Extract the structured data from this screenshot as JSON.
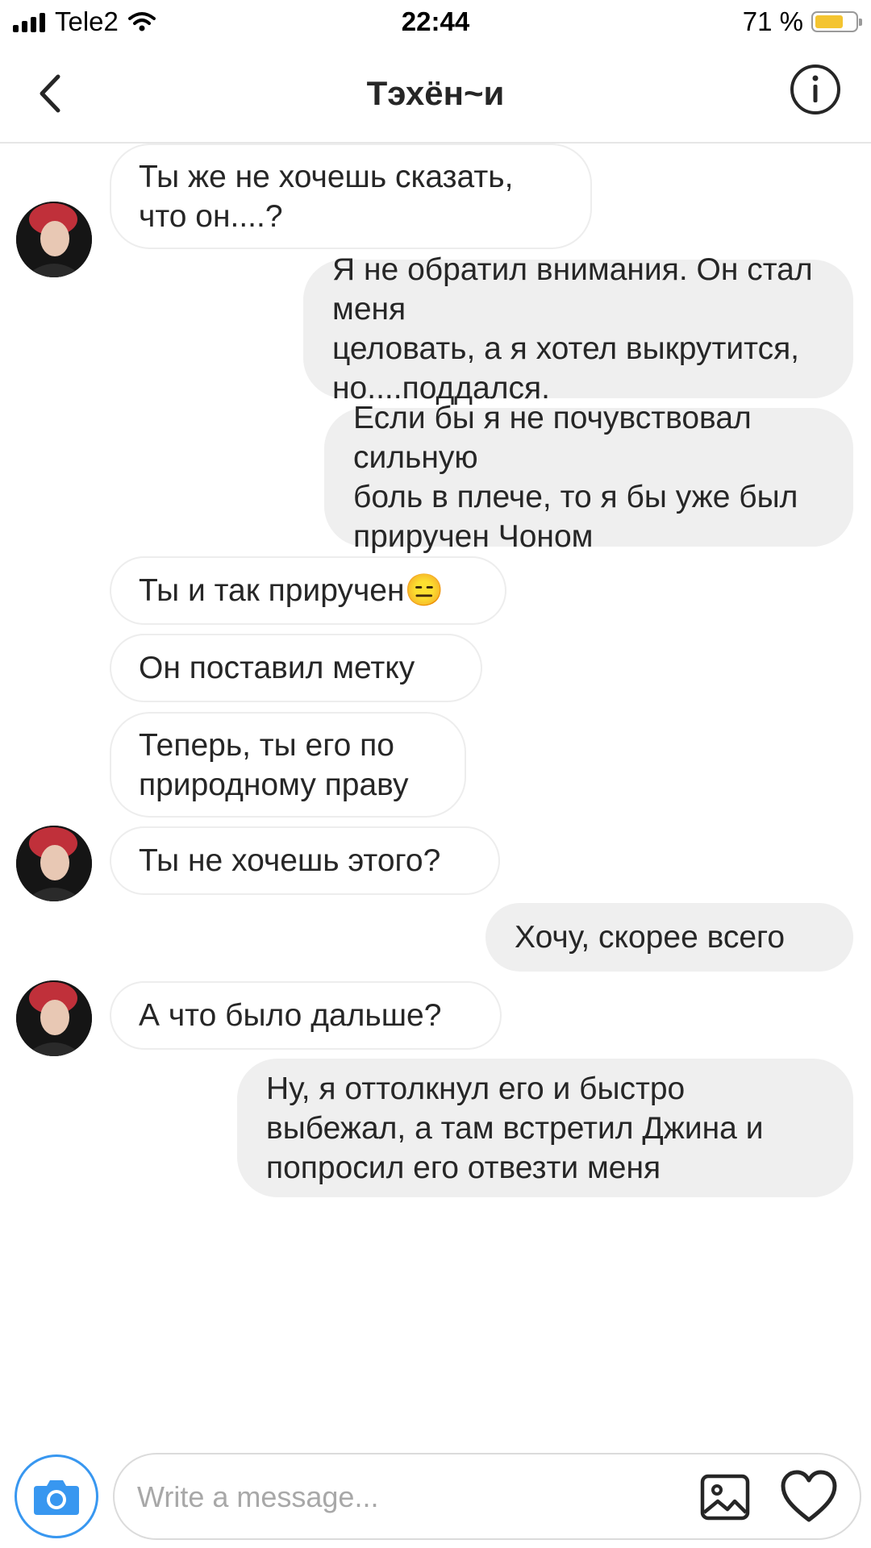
{
  "status_bar": {
    "carrier": "Tele2",
    "time": "22:44",
    "battery_percent": "71 %",
    "battery_level": 0.71
  },
  "header": {
    "title": "Тэхён~и"
  },
  "messages": [
    {
      "text": "Ты же не хочешь сказать,\nчто он....?",
      "direction": "in",
      "avatar": true
    },
    {
      "text": "Я не обратил внимания. Он стал меня\nцеловать, а я хотел выкрутится,\nно....поддался.",
      "direction": "out",
      "avatar": false
    },
    {
      "text": "Если бы я не почувствовал сильную\nболь в плече, то я бы уже был\nприручен Чоном",
      "direction": "out",
      "avatar": false
    },
    {
      "text": "Ты и так приручен😑",
      "direction": "in",
      "avatar": false
    },
    {
      "text": "Он поставил метку",
      "direction": "in",
      "avatar": false
    },
    {
      "text": "Теперь, ты его по\nприродному праву",
      "direction": "in",
      "avatar": false
    },
    {
      "text": "Ты не хочешь этого?",
      "direction": "in",
      "avatar": true
    },
    {
      "text": "Хочу, скорее всего",
      "direction": "out",
      "avatar": false
    },
    {
      "text": "А что было дальше?",
      "direction": "in",
      "avatar": true
    },
    {
      "text": "Ну, я оттолкнул его и быстро\nвыбежал, а там встретил Джина и\nпопросил его отвезти меня",
      "direction": "out",
      "avatar": false
    }
  ],
  "composer": {
    "placeholder": "Write a message..."
  },
  "colors": {
    "accent": "#3897f0",
    "incoming_bg": "#ffffff",
    "outgoing_bg": "#efefef",
    "battery": "#f4c430"
  },
  "icons": {
    "back": "chevron-left-icon",
    "info": "info-icon",
    "camera": "camera-icon",
    "gallery": "image-icon",
    "like": "heart-icon"
  }
}
